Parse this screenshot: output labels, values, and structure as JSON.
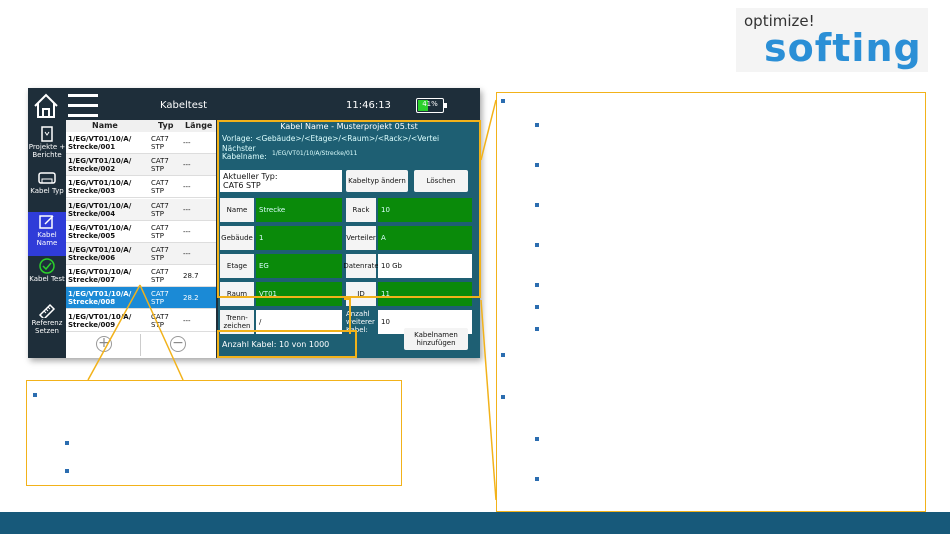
{
  "logo": {
    "top": "optimize!",
    "brand": "softing"
  },
  "device": {
    "title": "Kabeltest",
    "time": "11:46:13",
    "battery": "41%",
    "battery_level": 0.41,
    "nav": [
      {
        "label": "Projekte + Berichte",
        "icon": "report-icon"
      },
      {
        "label": "Kabel Typ",
        "icon": "cable-type-icon"
      },
      {
        "label": "Kabel Name",
        "icon": "edit-icon",
        "active": true
      },
      {
        "label": "Kabel Test",
        "icon": "check-icon"
      },
      {
        "label": "Referenz Setzen",
        "icon": "ruler-icon"
      }
    ],
    "list_headers": {
      "name": "Name",
      "typ": "Typ",
      "len": "Länge"
    },
    "rows": [
      {
        "name": "1/EG/VT01/10/A/ Strecke/001",
        "typ": "CAT7 STP",
        "len": "---"
      },
      {
        "name": "1/EG/VT01/10/A/ Strecke/002",
        "typ": "CAT7 STP",
        "len": "---"
      },
      {
        "name": "1/EG/VT01/10/A/ Strecke/003",
        "typ": "CAT7 STP",
        "len": "---"
      },
      {
        "name": "1/EG/VT01/10/A/ Strecke/004",
        "typ": "CAT7 STP",
        "len": "---"
      },
      {
        "name": "1/EG/VT01/10/A/ Strecke/005",
        "typ": "CAT7 STP",
        "len": "---"
      },
      {
        "name": "1/EG/VT01/10/A/ Strecke/006",
        "typ": "CAT7 STP",
        "len": "---"
      },
      {
        "name": "1/EG/VT01/10/A/ Strecke/007",
        "typ": "CAT7 STP",
        "len": "28.7"
      },
      {
        "name": "1/EG/VT01/10/A/ Strecke/008",
        "typ": "CAT7 STP",
        "len": "28.2",
        "selected": true
      },
      {
        "name": "1/EG/VT01/10/A/ Strecke/009",
        "typ": "CAT7 STP",
        "len": "---"
      }
    ],
    "panel": {
      "title": "Kabel Name - Musterprojekt 05.tst",
      "vorlage_label": "Vorlage:",
      "vorlage_value": "<Gebäude>/<Etage>/<Raum>/<Rack>/<Vertei",
      "next_label": "Nächster Kabelname:",
      "next_value": "1/EG/VT01/10/A/Strecke/011",
      "current_type_label": "Aktueller Typ:",
      "current_type_value": "CAT6 STP",
      "btn_change": "Kabeltyp ändern",
      "btn_delete": "Löschen",
      "fields": [
        {
          "label": "Name",
          "value": "Strecke",
          "green": true
        },
        {
          "label": "Rack",
          "value": "10",
          "green": true
        },
        {
          "label": "Gebäude",
          "value": "1",
          "green": true
        },
        {
          "label": "Verteiler",
          "value": "A",
          "green": true
        },
        {
          "label": "Etage",
          "value": "EG",
          "green": true
        },
        {
          "label": "Datenrate",
          "value": "10 Gb",
          "green": false
        },
        {
          "label": "Raum",
          "value": "VT01",
          "green": true
        },
        {
          "label": "ID",
          "value": "11",
          "green": true
        },
        {
          "label": "Trenn-zeichen",
          "value": "/",
          "green": false
        },
        {
          "label": "Anzahl weiterer Kabel:",
          "value": "10",
          "green": false
        }
      ],
      "count_text": "Anzahl Kabel: 10 von 1000",
      "btn_add": "Kabelnamen hinzufügen"
    }
  }
}
